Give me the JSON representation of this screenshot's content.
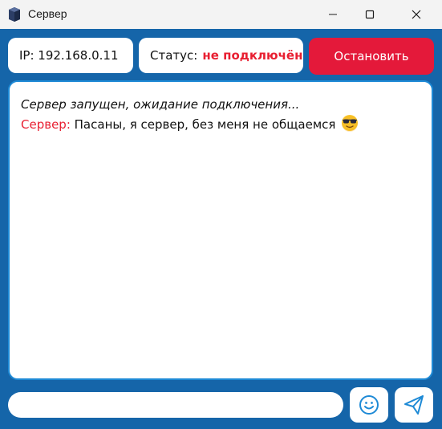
{
  "window": {
    "title": "Сервер"
  },
  "header": {
    "ip_text": "IP: 192.168.0.11",
    "status_label": "Статус:",
    "status_value": "не подключён",
    "stop_button_label": "Остановить"
  },
  "chat": {
    "system_message": "Сервер запущен, ожидание подключения...",
    "messages": [
      {
        "sender": "Сервер:",
        "text": "Пасаны, я сервер, без меня не общаемся",
        "emoji": "smiling-face-with-sunglasses"
      }
    ]
  },
  "composer": {
    "input_value": "",
    "emoji_icon": "smiley-face-icon",
    "send_icon": "paper-plane-icon"
  },
  "colors": {
    "accent_blue": "#1565a9",
    "stop_red": "#e4193a",
    "status_red": "#e81f31",
    "icon_blue": "#1e8ad6"
  }
}
